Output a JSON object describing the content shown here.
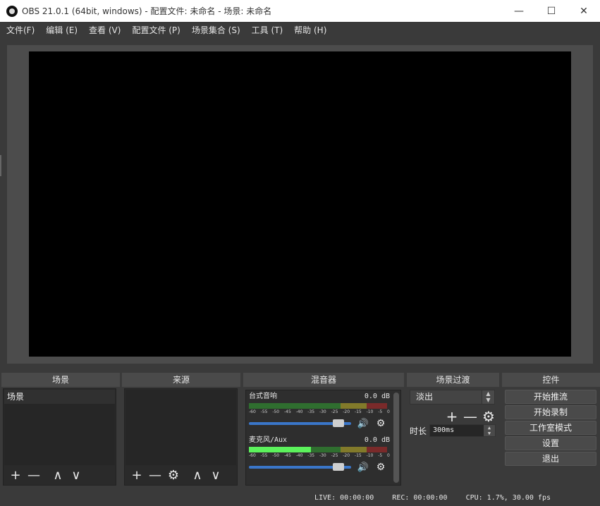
{
  "window": {
    "title": "OBS 21.0.1 (64bit, windows) - 配置文件: 未命名 - 场景: 未命名",
    "minimize": "—",
    "maximize": "☐",
    "close": "✕"
  },
  "menu": [
    "文件(F)",
    "编辑 (E)",
    "查看 (V)",
    "配置文件 (P)",
    "场景集合 (S)",
    "工具 (T)",
    "帮助 (H)"
  ],
  "docks": {
    "scenes": {
      "title": "场景",
      "items": [
        "场景"
      ]
    },
    "sources": {
      "title": "来源",
      "items": []
    },
    "mixer": {
      "title": "混音器",
      "tracks": [
        {
          "name": "台式音响",
          "db": "0.0 dB",
          "level_fraction": 0.0,
          "volume_fraction": 0.92
        },
        {
          "name": "麦克风/Aux",
          "db": "0.0 dB",
          "level_fraction": 0.45,
          "volume_fraction": 0.92
        }
      ],
      "scale": [
        "-60",
        "-55",
        "-50",
        "-45",
        "-40",
        "-35",
        "-30",
        "-25",
        "-20",
        "-15",
        "-10",
        "-5",
        "0"
      ]
    },
    "transitions": {
      "title": "场景过渡",
      "selected": "淡出",
      "duration_label": "时长",
      "duration_value": "300ms"
    },
    "controls": {
      "title": "控件",
      "buttons": [
        "开始推流",
        "开始录制",
        "工作室模式",
        "设置",
        "退出"
      ]
    }
  },
  "status": {
    "live": "LIVE: 00:00:00",
    "rec": "REC: 00:00:00",
    "cpu": "CPU: 1.7%, 30.00 fps"
  },
  "icons": {
    "plus": "+",
    "minus": "—",
    "up": "∧",
    "down": "∨",
    "gear": "⚙",
    "volume": "🔊"
  }
}
